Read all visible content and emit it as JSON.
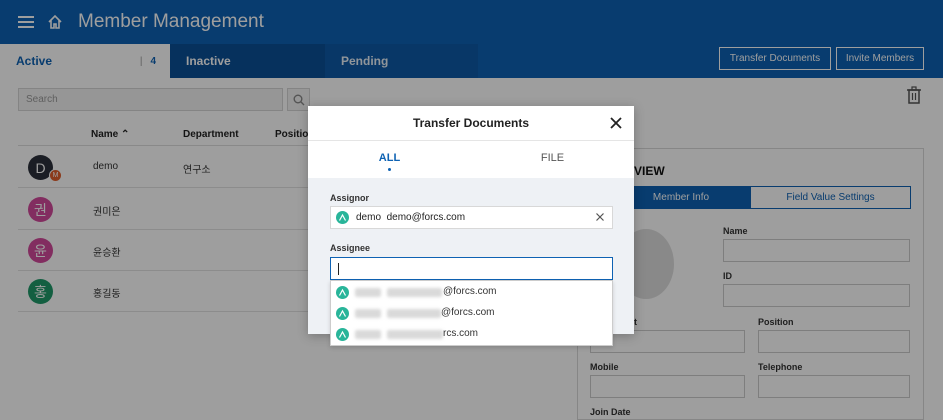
{
  "header": {
    "title": "Member Management"
  },
  "tabs": {
    "active": {
      "label": "Active",
      "count": "4"
    },
    "inactive": {
      "label": "Inactive"
    },
    "pending": {
      "label": "Pending"
    }
  },
  "toolbar": {
    "transfer_label": "Transfer Documents",
    "invite_label": "Invite Members"
  },
  "search": {
    "placeholder": "Search"
  },
  "list": {
    "columns": {
      "name": "Name ⌃",
      "department": "Department",
      "position": "Position"
    },
    "rows": [
      {
        "initial": "D",
        "name": "demo",
        "department": "연구소",
        "color": "#2b2f3a",
        "badge": "M"
      },
      {
        "initial": "권",
        "name": "권미은",
        "department": "",
        "color": "#d24a9b",
        "badge": ""
      },
      {
        "initial": "윤",
        "name": "윤승환",
        "department": "",
        "color": "#d24a9b",
        "badge": ""
      },
      {
        "initial": "홍",
        "name": "홍길동",
        "department": "",
        "color": "#1f9a6a",
        "badge": ""
      }
    ]
  },
  "panel": {
    "title": "VIEW",
    "tab_info": "Member Info",
    "tab_field": "Field Value Settings",
    "labels": {
      "name": "Name",
      "id": "ID",
      "t": "t",
      "position": "Position",
      "mobile": "Mobile",
      "telephone": "Telephone",
      "join_date": "Join Date"
    }
  },
  "modal": {
    "title": "Transfer Documents",
    "tab_all": "ALL",
    "tab_file": "FILE",
    "assignor_label": "Assignor",
    "assignor_value": "demo  demo@forcs.com",
    "assignee_label": "Assignee",
    "assignee_value": "",
    "suggestions": [
      {
        "visible_text": "@forcs.com"
      },
      {
        "visible_text": "@forcs.com"
      },
      {
        "visible_text": "rcs.com"
      }
    ]
  },
  "colors": {
    "primary": "#0e62b3",
    "avatar_green": "#29b59a",
    "badge_orange": "#e05e2d"
  }
}
